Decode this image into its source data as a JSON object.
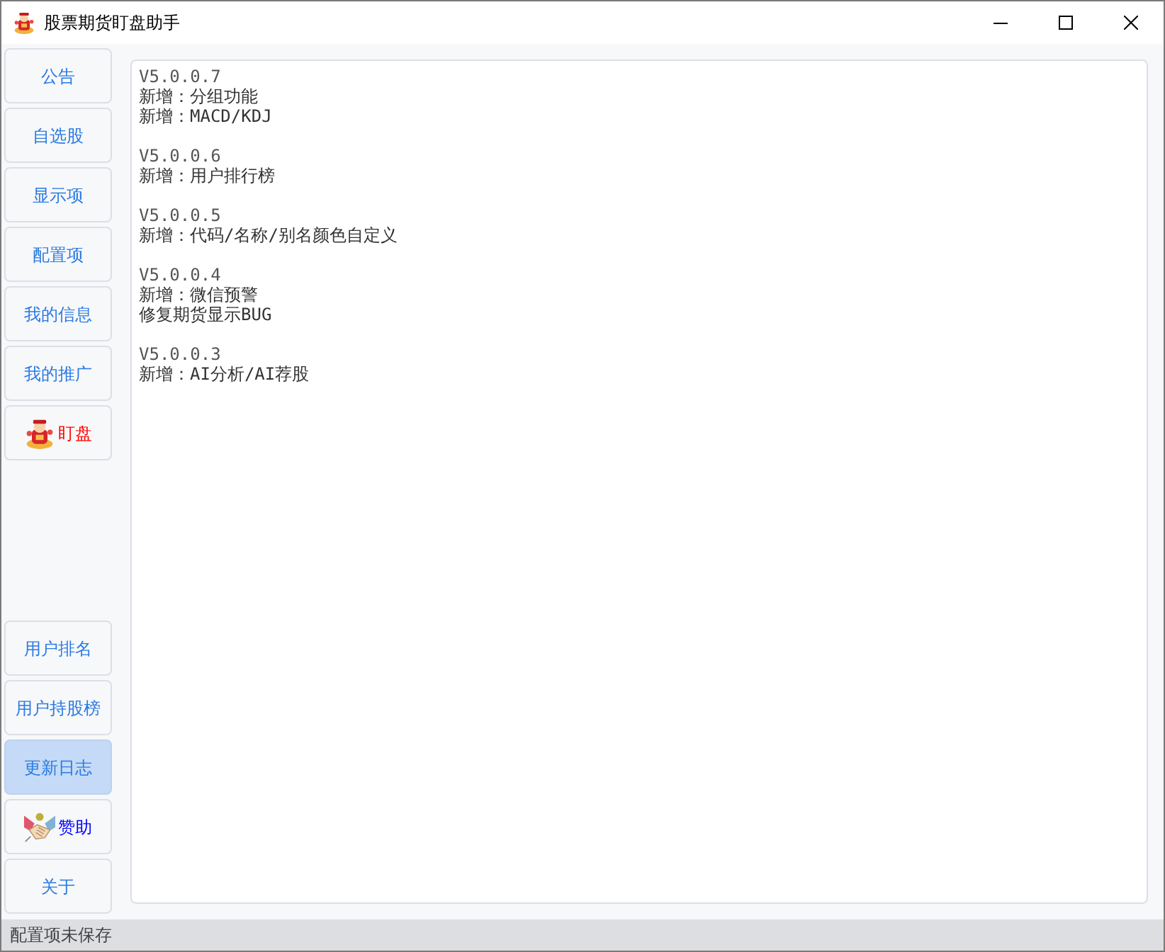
{
  "window": {
    "title": "股票期货盯盘助手"
  },
  "sidebar": {
    "top_items": [
      {
        "label": "公告",
        "selected": false,
        "kind": "text",
        "color": "#2a7ae2"
      },
      {
        "label": "自选股",
        "selected": false,
        "kind": "text",
        "color": "#2a7ae2"
      },
      {
        "label": "显示项",
        "selected": false,
        "kind": "text",
        "color": "#2a7ae2"
      },
      {
        "label": "配置项",
        "selected": false,
        "kind": "text",
        "color": "#2a7ae2"
      },
      {
        "label": "我的信息",
        "selected": false,
        "kind": "text",
        "color": "#2a7ae2"
      },
      {
        "label": "我的推广",
        "selected": false,
        "kind": "text",
        "color": "#2a7ae2"
      },
      {
        "label": "盯盘",
        "selected": false,
        "kind": "figure",
        "color": "#ff0000"
      }
    ],
    "bottom_items": [
      {
        "label": "用户排名",
        "selected": false,
        "kind": "text",
        "color": "#2a7ae2"
      },
      {
        "label": "用户持股榜",
        "selected": false,
        "kind": "text",
        "color": "#2a7ae2"
      },
      {
        "label": "更新日志",
        "selected": true,
        "kind": "text",
        "color": "#2a7ae2"
      },
      {
        "label": "赞助",
        "selected": false,
        "kind": "handshake",
        "color": "#0000ff"
      },
      {
        "label": "关于",
        "selected": false,
        "kind": "text",
        "color": "#2a7ae2"
      }
    ]
  },
  "changelog": [
    {
      "version": "V5.0.0.7",
      "items": [
        "新增：分组功能",
        "新增：MACD/KDJ"
      ]
    },
    {
      "version": "V5.0.0.6",
      "items": [
        "新增：用户排行榜"
      ]
    },
    {
      "version": "V5.0.0.5",
      "items": [
        "新增：代码/名称/别名颜色自定义"
      ]
    },
    {
      "version": "V5.0.0.4",
      "items": [
        "新增：微信预警",
        "修复期货显示BUG"
      ]
    },
    {
      "version": "V5.0.0.3",
      "items": [
        "新增：AI分析/AI荐股"
      ]
    }
  ],
  "status_bar": {
    "text": "配置项未保存"
  }
}
